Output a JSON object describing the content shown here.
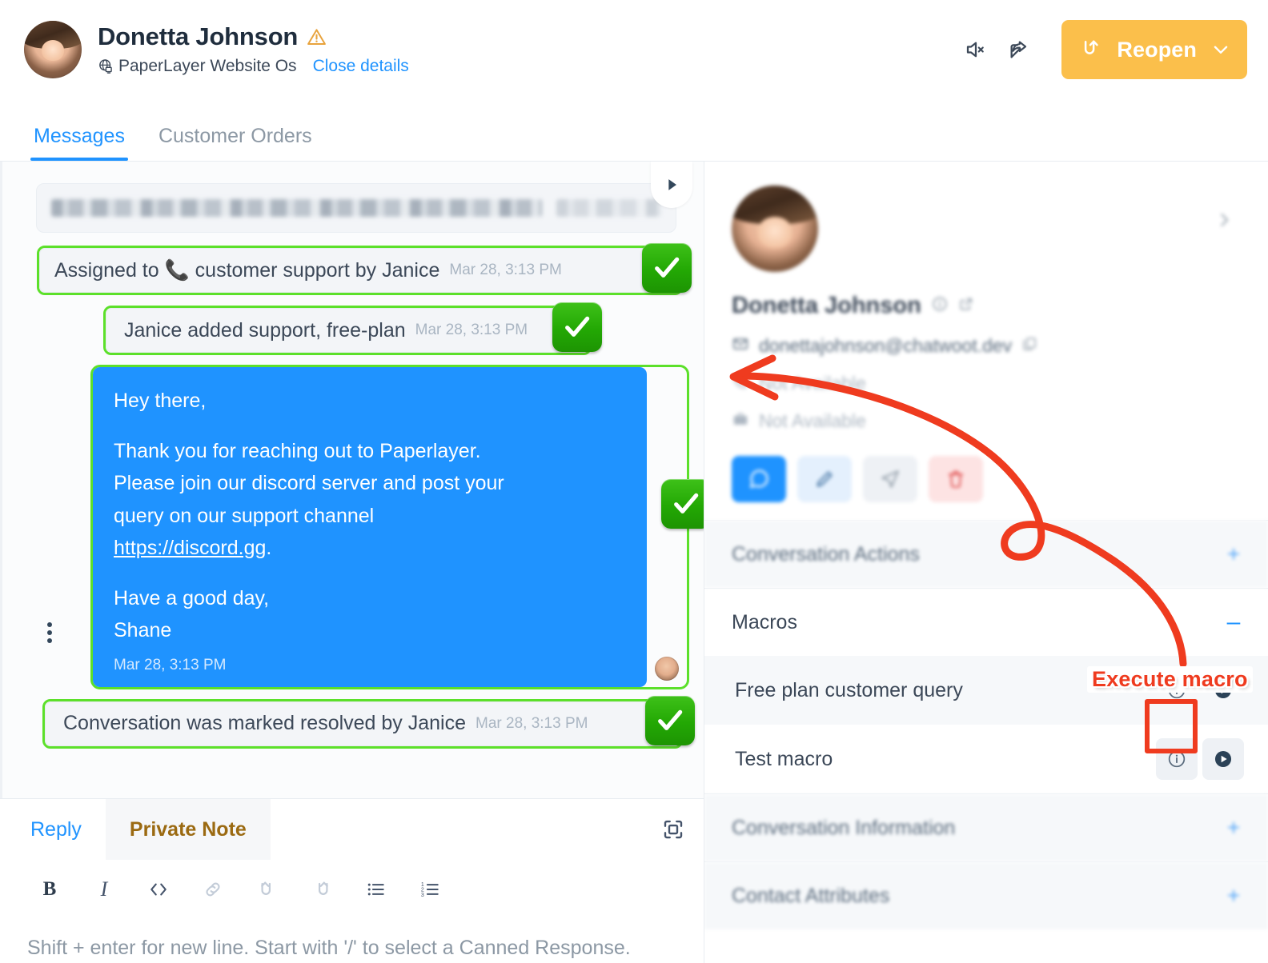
{
  "header": {
    "contact_name": "Donetta Johnson",
    "warning_icon": "warning-triangle-icon",
    "inbox_icon": "globe-website-icon",
    "inbox_name": "PaperLayer Website Os",
    "close_details_label": "Close details",
    "mute_icon": "speaker-mute-icon",
    "share_icon": "share-forward-icon",
    "reopen_label": "Reopen",
    "reopen_icon": "reopen-arrow-icon",
    "reopen_dropdown_icon": "chevron-down-icon",
    "reopen_color": "#FBBF4B"
  },
  "tabs": [
    {
      "label": "Messages",
      "active": true
    },
    {
      "label": "Customer Orders",
      "active": false
    }
  ],
  "messages": {
    "scroll_tab_icon": "play-triangle-icon",
    "activity_blurred": {
      "redacted": true,
      "note": "blurred activity entry"
    },
    "items": [
      {
        "type": "system",
        "text": "Assigned to 📞 customer support by Janice",
        "time": "Mar 28, 3:13 PM",
        "highlighted": true,
        "badge": "green-check-badge"
      },
      {
        "type": "system",
        "text": "Janice added support, free-plan",
        "time": "Mar 28, 3:13 PM",
        "highlighted": true,
        "badge": "green-check-badge"
      },
      {
        "type": "outgoing",
        "lines": [
          "Hey there,",
          "",
          "Thank you for reaching out to Paperlayer.",
          "Please join our discord server and post your",
          "query on our support channel",
          "LINK.",
          "",
          "Have a good day,",
          "Shane"
        ],
        "link_text": "https://discord.gg",
        "time": "Mar 28, 3:13 PM",
        "highlighted": true,
        "badge": "green-check-badge",
        "menu_icon": "more-vertical-icon",
        "sender_avatar": "agent-avatar"
      },
      {
        "type": "system",
        "text": "Conversation was marked resolved by Janice",
        "time": "Mar 28, 3:13 PM",
        "highlighted": true,
        "badge": "green-check-badge"
      }
    ]
  },
  "reply": {
    "tabs": [
      {
        "label": "Reply",
        "active": true
      },
      {
        "label": "Private Note",
        "active": false
      }
    ],
    "expand_icon": "expand-fullscreen-icon",
    "toolbar": [
      {
        "name": "bold-button",
        "glyph": "B"
      },
      {
        "name": "italic-button",
        "glyph": "I"
      },
      {
        "name": "code-button",
        "glyph": "</>"
      },
      {
        "name": "link-button",
        "glyph": "link-icon"
      },
      {
        "name": "undo-button",
        "glyph": "undo-icon"
      },
      {
        "name": "redo-button",
        "glyph": "redo-icon"
      },
      {
        "name": "bullet-list-button",
        "glyph": "bullet-list-icon"
      },
      {
        "name": "numbered-list-button",
        "glyph": "numbered-list-icon"
      }
    ],
    "placeholder": "Shift + enter for new line. Start with '/' to select a Canned Response."
  },
  "sidebar": {
    "contact": {
      "avatar": "contact-avatar",
      "name": "Donetta Johnson",
      "info_icon": "info-circle-icon",
      "external_icon": "external-link-icon",
      "email_icon": "email-icon",
      "email": "donettajohnson@chatwoot.dev",
      "copy_icon": "copy-icon",
      "phone_icon": "phone-icon",
      "phone": "Not Available",
      "company_icon": "briefcase-icon",
      "company": "Not Available",
      "collapse_icon": "chevron-right-icon",
      "actions": [
        {
          "name": "conversation-action-button",
          "icon": "chat-bubble-icon",
          "color": "#1f93ff"
        },
        {
          "name": "edit-contact-button",
          "icon": "pencil-icon",
          "color": "#e4f0fd"
        },
        {
          "name": "merge-contact-button",
          "icon": "send-icon",
          "color": "#eef1f5"
        },
        {
          "name": "delete-contact-button",
          "icon": "trash-icon",
          "color": "#fde3e3"
        }
      ]
    },
    "sections": [
      {
        "title": "Conversation Actions",
        "state": "collapsed",
        "sign": "+",
        "blurred": true
      },
      {
        "title": "Macros",
        "state": "expanded",
        "sign": "–",
        "blurred": false
      },
      {
        "title": "Conversation Information",
        "state": "collapsed",
        "sign": "+",
        "blurred": true
      },
      {
        "title": "Contact Attributes",
        "state": "collapsed",
        "sign": "+",
        "blurred": true
      }
    ],
    "macros": [
      {
        "name": "Free plan customer query",
        "info_icon": "info-circle-icon",
        "run_icon": "play-circle-icon",
        "highlighted": true
      },
      {
        "name": "Test macro",
        "info_icon": "info-circle-icon",
        "run_icon": "play-circle-icon",
        "highlighted": false
      }
    ]
  },
  "annotations": {
    "execute_macro_label": "Execute macro",
    "annotation_color": "#ef3b1f",
    "highlight_color": "#5ce02a",
    "arrow": "curved-red-arrow-pointing-left"
  }
}
